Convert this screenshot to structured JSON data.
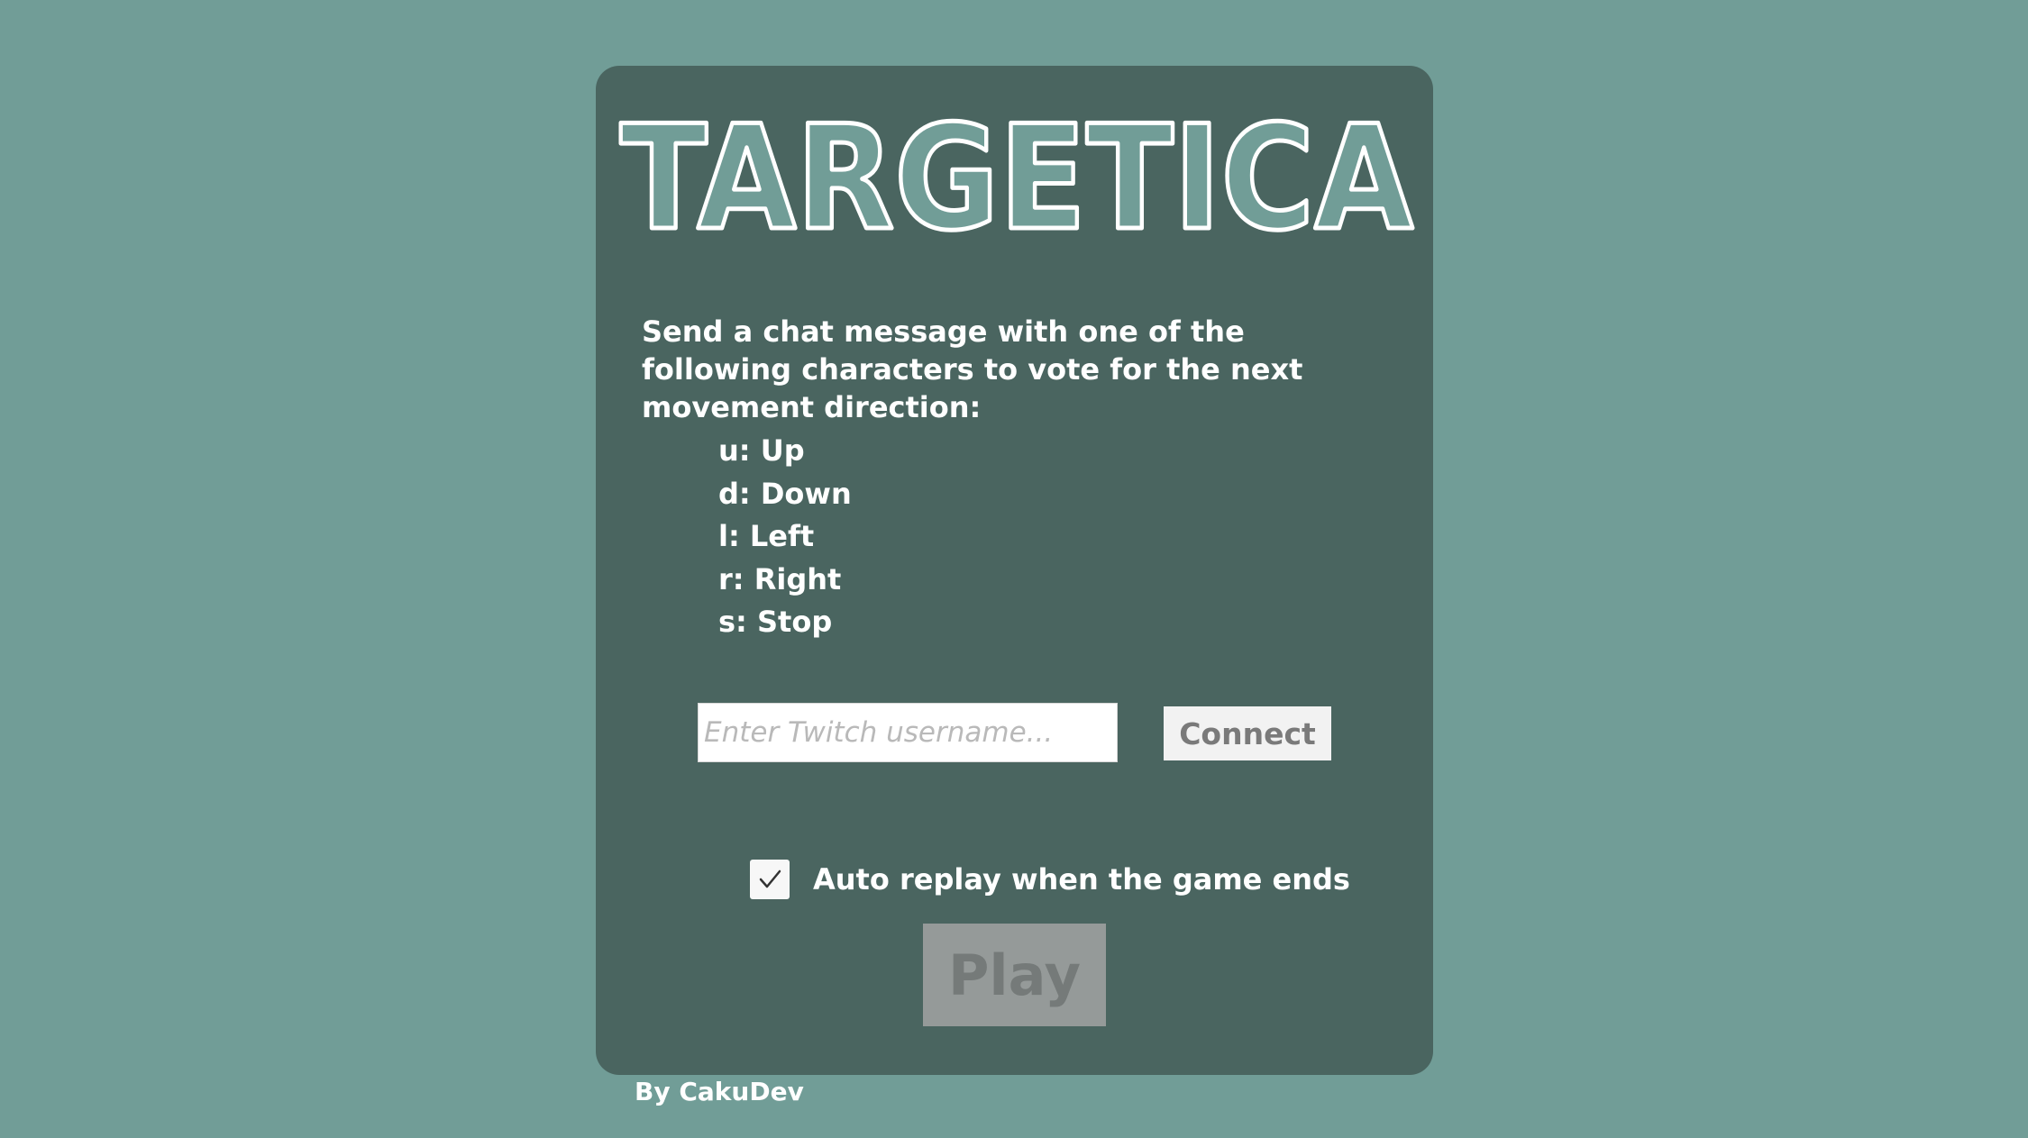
{
  "game": {
    "title": "TARGETICA",
    "instructions": "Send a chat message with one of the following characters to vote for the next movement direction:",
    "directions": [
      {
        "label": "u: Up"
      },
      {
        "label": "d: Down"
      },
      {
        "label": "l: Left"
      },
      {
        "label": "r: Right"
      },
      {
        "label": "s: Stop"
      }
    ],
    "username_input": {
      "value": "",
      "placeholder": "Enter Twitch username..."
    },
    "connect_label": "Connect",
    "auto_replay": {
      "checked": true,
      "label": "Auto replay when the game ends"
    },
    "play_label": "Play",
    "credit": "By CakuDev"
  },
  "colors": {
    "background": "#719d97",
    "panel": "#4a6560",
    "logo_fill": "#719d97",
    "logo_outline": "#ffffff",
    "play_disabled": "#959a99"
  }
}
